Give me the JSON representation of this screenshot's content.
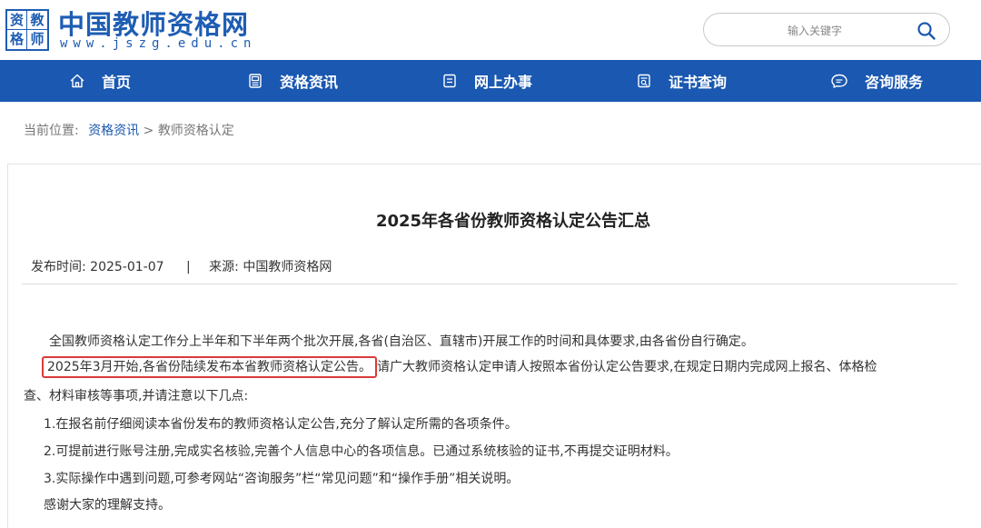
{
  "header": {
    "logo_chars": [
      "资",
      "教",
      "格",
      "师"
    ],
    "site_name": "中国教师资格网",
    "site_url": "www.jszg.edu.cn",
    "search_placeholder": "输入关键字",
    "search_icon": "search-icon"
  },
  "nav": {
    "items": [
      {
        "label": "首页",
        "icon": "home-icon"
      },
      {
        "label": "资格资讯",
        "icon": "news-icon"
      },
      {
        "label": "网上办事",
        "icon": "document-icon"
      },
      {
        "label": "证书查询",
        "icon": "certificate-icon"
      },
      {
        "label": "咨询服务",
        "icon": "chat-icon"
      }
    ]
  },
  "breadcrumb": {
    "prefix": "当前位置:",
    "link": "资格资讯",
    "separator": ">",
    "current": "教师资格认定"
  },
  "article": {
    "title": "2025年各省份教师资格认定公告汇总",
    "publish_label": "发布时间:",
    "publish_date": "2025-01-07",
    "meta_separator": "|",
    "source_label": "来源:",
    "source": "中国教师资格网",
    "p1": "全国教师资格认定工作分上半年和下半年两个批次开展,各省(自治区、直辖市)开展工作的时间和具体要求,由各省份自行确定。",
    "p2_highlight": "2025年3月开始,各省份陆续发布本省教师资格认定公告。",
    "p2_rest": "请广大教师资格认定申请人按照本省份认定公告要求,在规定日期内完成网上报名、体格检",
    "p2_cont": "查、材料审核等事项,并请注意以下几点:",
    "item1": "1.在报名前仔细阅读本省份发布的教师资格认定公告,充分了解认定所需的各项条件。",
    "item2": "2.可提前进行账号注册,完成实名核验,完善个人信息中心的各项信息。已通过系统核验的证书,不再提交证明材料。",
    "item3": "3.实际操作中遇到问题,可参考网站“咨询服务”栏“常见问题”和“操作手册”相关说明。",
    "closing": "感谢大家的理解支持。"
  },
  "colors": {
    "brand": "#1a58b1",
    "highlight_border": "#d93a3a"
  }
}
